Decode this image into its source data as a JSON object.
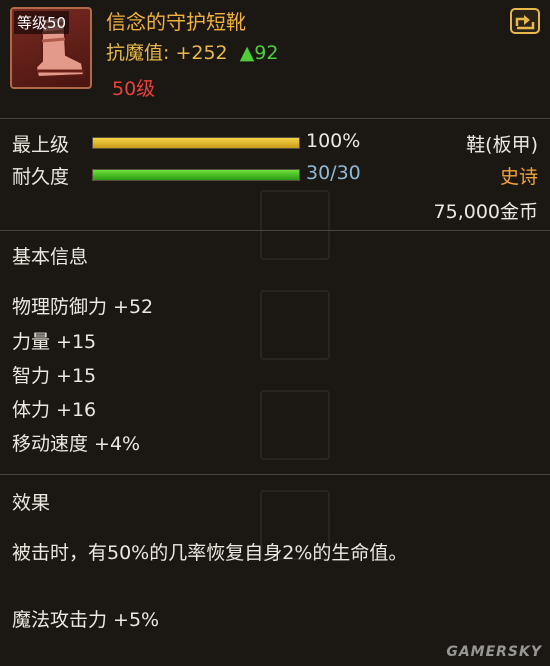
{
  "item": {
    "level_badge": "等级50",
    "name": "信念的守护短靴",
    "resist_label": "抗魔值:",
    "resist_value": "+252",
    "resist_increase": "▲92",
    "required_level": "50级",
    "icon": "boot-icon"
  },
  "share_icon": "share-arrow-icon",
  "stats": {
    "upgrade_label": "最上级",
    "upgrade_value": "100%",
    "upgrade_fraction": 1.0,
    "durability_label": "耐久度",
    "durability_value": "30/30",
    "durability_fraction": 1.0,
    "type": "鞋(板甲)",
    "rarity": "史诗",
    "price": "75,000金币"
  },
  "basic_info": {
    "title": "基本信息",
    "attributes": [
      "物理防御力 +52",
      "力量 +15",
      "智力 +15",
      "体力 +16",
      "移动速度 +4%"
    ]
  },
  "effect": {
    "title": "效果",
    "description": "被击时，有50%的几率恢复自身2%的生命值。",
    "bonus": "魔法攻击力 +5%"
  },
  "watermark": "GAMERSKY",
  "colors": {
    "item_name": "#f2b03c",
    "required_level": "#e8423a",
    "rarity": "#f2a23a",
    "resist_increase": "#4ecf3a",
    "durability_value": "#8fb9d9"
  }
}
